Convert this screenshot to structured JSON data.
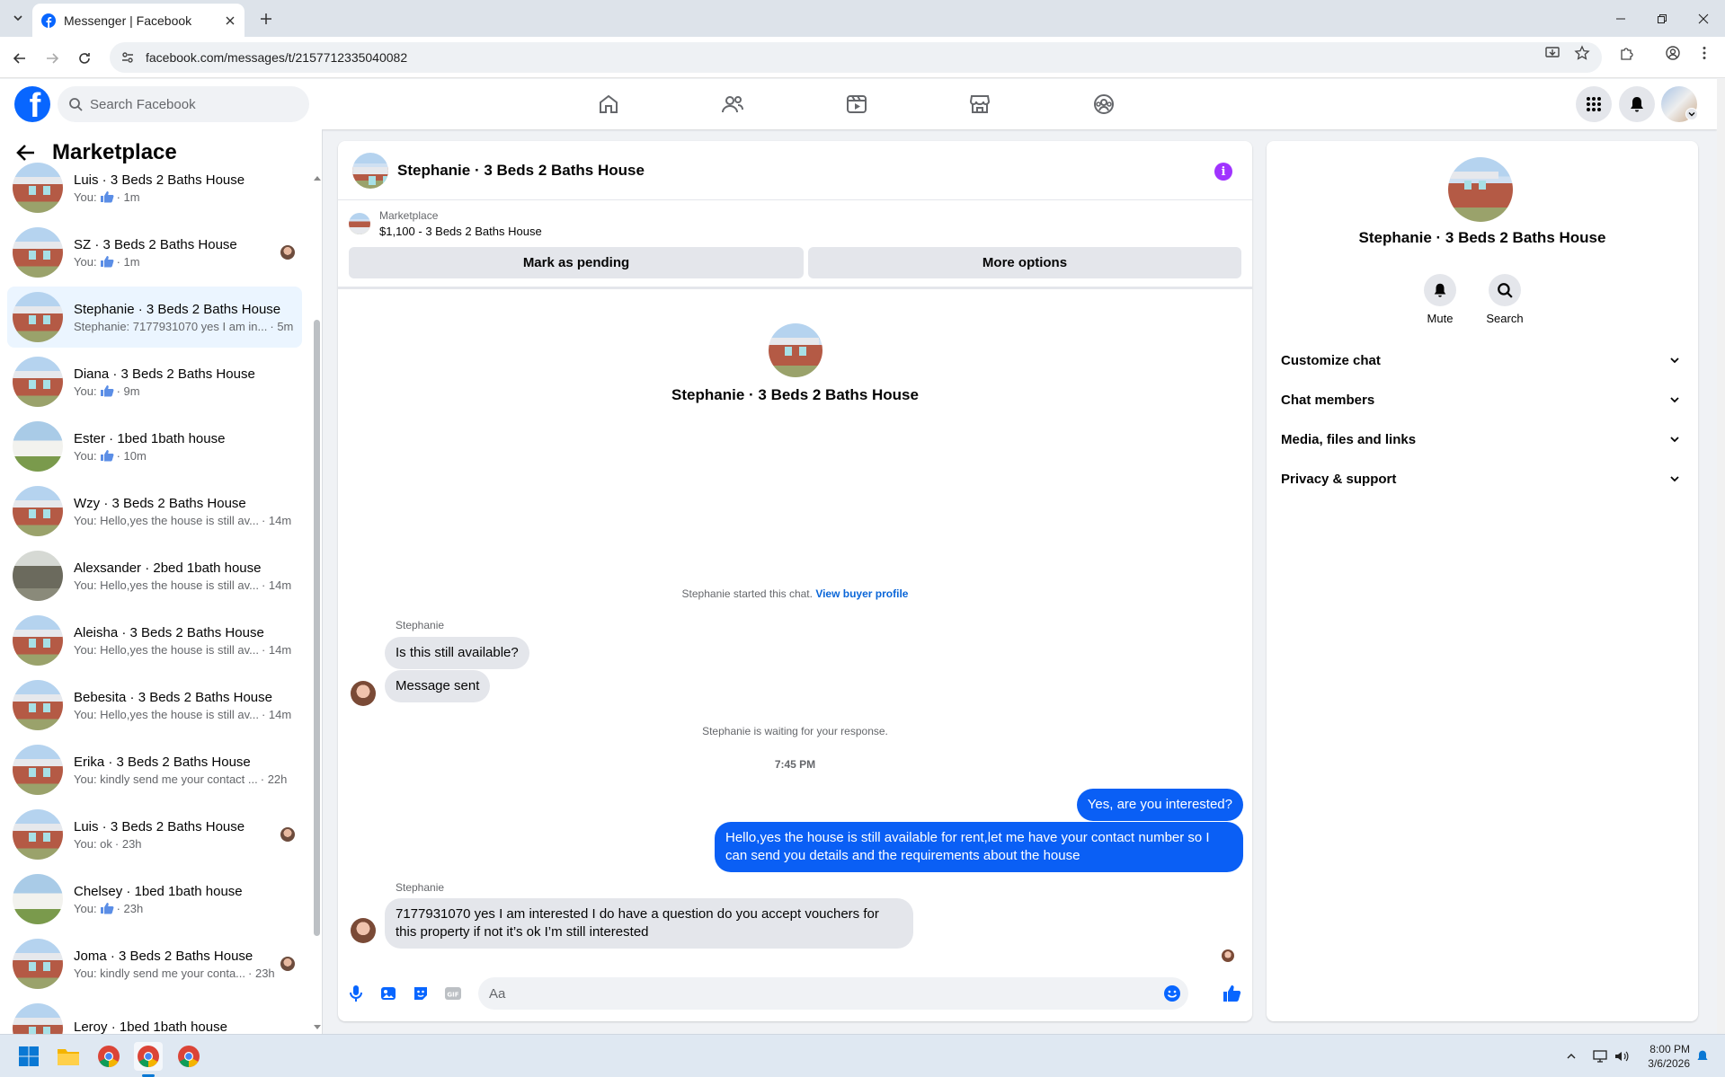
{
  "browser": {
    "tab_title": "Messenger | Facebook",
    "url": "facebook.com/messages/t/2157712335040082"
  },
  "facebook": {
    "search_placeholder": "Search Facebook"
  },
  "left_panel": {
    "title": "Marketplace",
    "conversations": [
      {
        "name": "Luis · 3 Beds 2 Baths House",
        "preview": "You:",
        "liked": true,
        "time": "· 1m",
        "thumb": "house",
        "seen": false,
        "selected": false
      },
      {
        "name": "SZ · 3 Beds 2 Baths House",
        "preview": "You:",
        "liked": true,
        "time": "· 1m",
        "thumb": "house",
        "seen": true,
        "selected": false
      },
      {
        "name": "Stephanie · 3 Beds 2 Baths House",
        "preview": "Stephanie: 7177931070 yes I am in...",
        "liked": false,
        "time": "· 5m",
        "thumb": "house",
        "seen": false,
        "selected": true
      },
      {
        "name": "Diana · 3 Beds 2 Baths House",
        "preview": "You:",
        "liked": true,
        "time": "· 9m",
        "thumb": "house",
        "seen": false,
        "selected": false
      },
      {
        "name": "Ester · 1bed 1bath house",
        "preview": "You:",
        "liked": true,
        "time": "· 10m",
        "thumb": "house2",
        "seen": false,
        "selected": false
      },
      {
        "name": "Wzy · 3 Beds 2 Baths House",
        "preview": "You: Hello,yes the house is still av...",
        "liked": false,
        "time": "· 14m",
        "thumb": "house",
        "seen": false,
        "selected": false
      },
      {
        "name": "Alexsander · 2bed 1bath house",
        "preview": "You: Hello,yes the house is still av...",
        "liked": false,
        "time": "· 14m",
        "thumb": "house3",
        "seen": false,
        "selected": false
      },
      {
        "name": "Aleisha · 3 Beds 2 Baths House",
        "preview": "You: Hello,yes the house is still av...",
        "liked": false,
        "time": "· 14m",
        "thumb": "house",
        "seen": false,
        "selected": false
      },
      {
        "name": "Bebesita · 3 Beds 2 Baths House",
        "preview": "You: Hello,yes the house is still av...",
        "liked": false,
        "time": "· 14m",
        "thumb": "house",
        "seen": false,
        "selected": false
      },
      {
        "name": "Erika · 3 Beds 2 Baths House",
        "preview": "You: kindly send me your contact ...",
        "liked": false,
        "time": "· 22h",
        "thumb": "house",
        "seen": false,
        "selected": false
      },
      {
        "name": "Luis · 3 Beds 2 Baths House",
        "preview": "You: ok",
        "liked": false,
        "time": "· 23h",
        "thumb": "house",
        "seen": true,
        "selected": false
      },
      {
        "name": "Chelsey · 1bed 1bath house",
        "preview": "You:",
        "liked": true,
        "time": "· 23h",
        "thumb": "house2",
        "seen": false,
        "selected": false
      },
      {
        "name": "Joma · 3 Beds 2 Baths House",
        "preview": "You: kindly send me your conta...",
        "liked": false,
        "time": "· 23h",
        "thumb": "house",
        "seen": true,
        "selected": false
      },
      {
        "name": "Leroy · 1bed 1bath house",
        "preview": "",
        "liked": false,
        "time": "",
        "thumb": "house",
        "seen": false,
        "selected": false
      }
    ]
  },
  "chat": {
    "title": "Stephanie · 3 Beds 2 Baths House",
    "marketplace_label": "Marketplace",
    "listing": "$1,100 - 3 Beds 2 Baths House",
    "mark_pending": "Mark as pending",
    "more_options": "More options",
    "intro_name": "Stephanie · 3 Beds 2 Baths House",
    "started_text": "Stephanie started this chat.",
    "view_profile": "View buyer profile",
    "sender_1": "Stephanie",
    "msg_1": "Is this still available?",
    "msg_2": "Message sent",
    "waiting": "Stephanie is waiting for your response.",
    "timestamp": "7:45 PM",
    "out_1": "Yes, are you interested?",
    "out_2": "Hello,yes the house is still available for rent,let me have your contact number so I can send you details and the requirements about the house",
    "sender_2": "Stephanie",
    "msg_3": "7177931070 yes I am interested I do have a question do you accept vouchers for this property if not it’s ok I’m still interested",
    "composer_placeholder": "Aa"
  },
  "right_panel": {
    "name": "Stephanie · 3 Beds 2 Baths House",
    "mute": "Mute",
    "search": "Search",
    "sections": [
      "Customize chat",
      "Chat members",
      "Media, files and links",
      "Privacy & support"
    ]
  },
  "taskbar": {
    "time": "8:00 PM",
    "date": "3/6/2026"
  },
  "colors": {
    "facebook_blue": "#0866ff",
    "outgoing_bubble": "#0a5ff5",
    "selected_row": "#ebf5ff",
    "info_purple": "#a033ff"
  }
}
